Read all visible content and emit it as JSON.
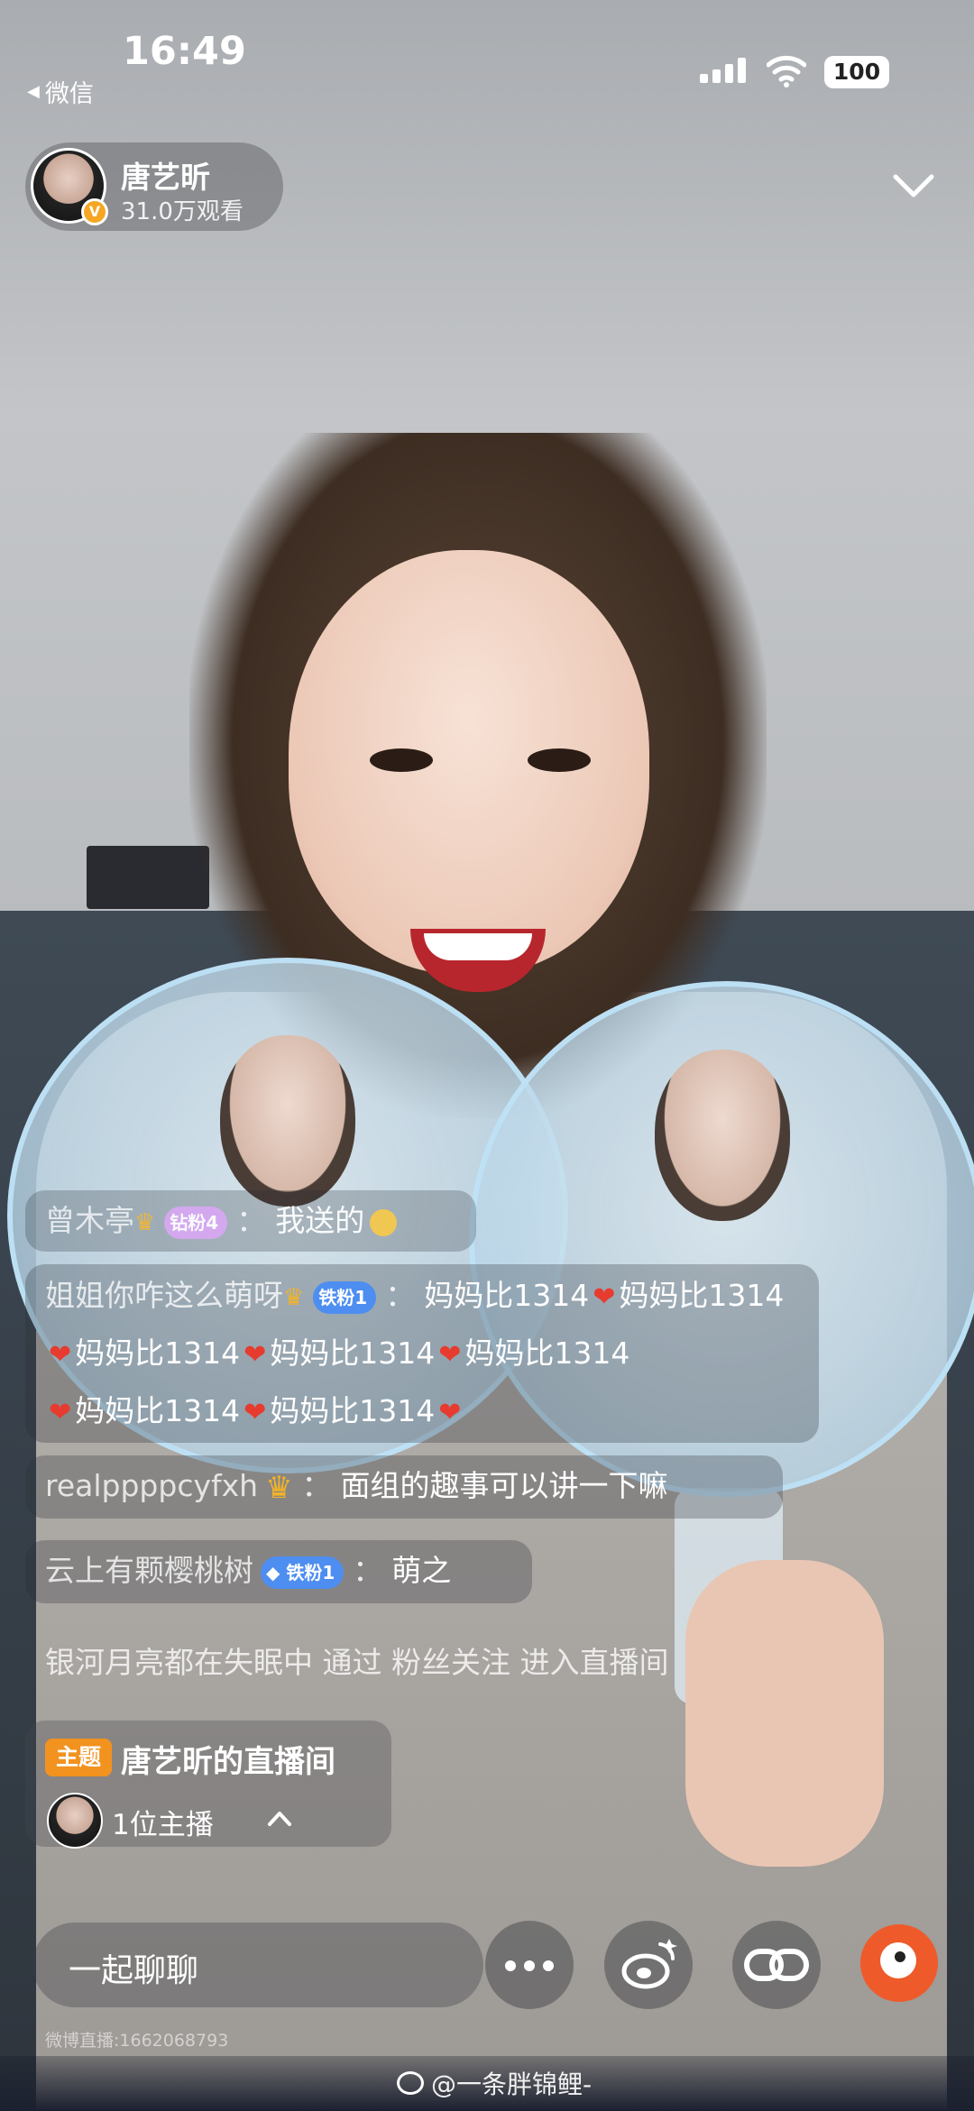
{
  "status_bar": {
    "time": "16:49",
    "back_app_label": "微信",
    "battery": "100"
  },
  "host": {
    "name": "唐艺昕",
    "viewers": "31.0万观看",
    "verified_mark": "V"
  },
  "comments": [
    {
      "user": "曾木亭",
      "badge": "钻粉4",
      "separator": "：",
      "text": "我送的"
    },
    {
      "user": "姐姐你咋这么萌呀",
      "badge": "铁粉1",
      "separator": "：",
      "segments": [
        "妈妈比1314",
        "妈妈比1314",
        "妈妈比1314",
        "妈妈比1314",
        "妈妈比1314",
        "妈妈比1314",
        "妈妈比1314"
      ]
    },
    {
      "user": "realppppcyfxh",
      "separator": "：",
      "text": "面组的趣事可以讲一下嘛"
    },
    {
      "user": "云上有颗樱桃树",
      "badge": "铁粉1",
      "separator": "：",
      "text": "萌之"
    },
    {
      "text": "银河月亮都在失眠中 通过 粉丝关注 进入直播间"
    }
  ],
  "topic": {
    "tag": "主题",
    "title": "唐艺昕的直播间",
    "anchor_count": "1位主播"
  },
  "bottom_bar": {
    "chat_placeholder": "一起聊聊"
  },
  "footer": {
    "live_id": "微博直播:1662068793",
    "watermark": "@一条胖锦鲤-"
  },
  "colors": {
    "topic_tag": "#f2921f",
    "heart": "#e63b2e",
    "iron_badge": "#4d8ef0",
    "diamond_badge": "#d5a3f0",
    "sunny_button": "#ef5a2a"
  }
}
